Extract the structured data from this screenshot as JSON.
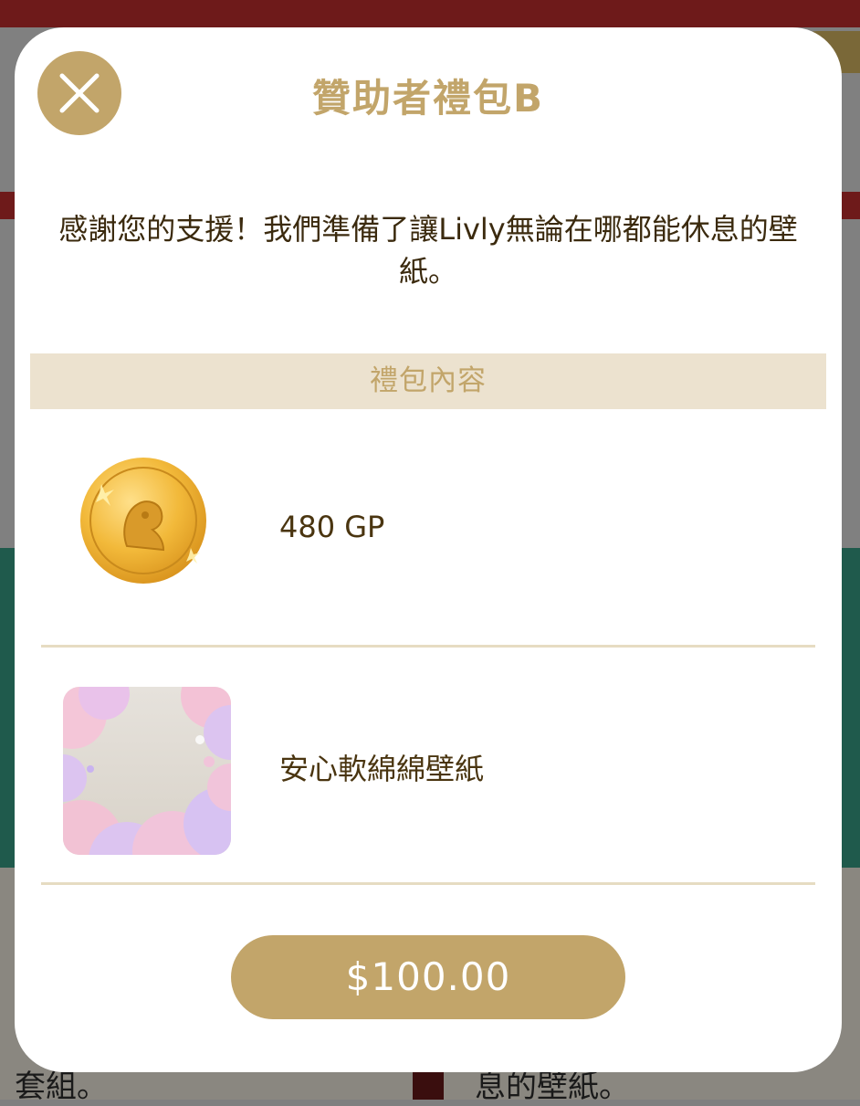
{
  "background": {
    "left_caption": "套組。",
    "right_caption": "息的壁紙。"
  },
  "modal": {
    "title": "贊助者禮包B",
    "description": "感謝您的支援！我們準備了讓Livly無論在哪都能休息的壁紙。",
    "section_header": "禮包內容",
    "items": [
      {
        "label": "480 GP",
        "icon": "gold-coin-icon"
      },
      {
        "label": "安心軟綿綿壁紙",
        "icon": "wallpaper-thumbnail"
      }
    ],
    "price": "$100.00"
  },
  "colors": {
    "accent": "#c2a56a",
    "section_bg": "#ece2cf",
    "text_dark": "#3b2a0e"
  }
}
